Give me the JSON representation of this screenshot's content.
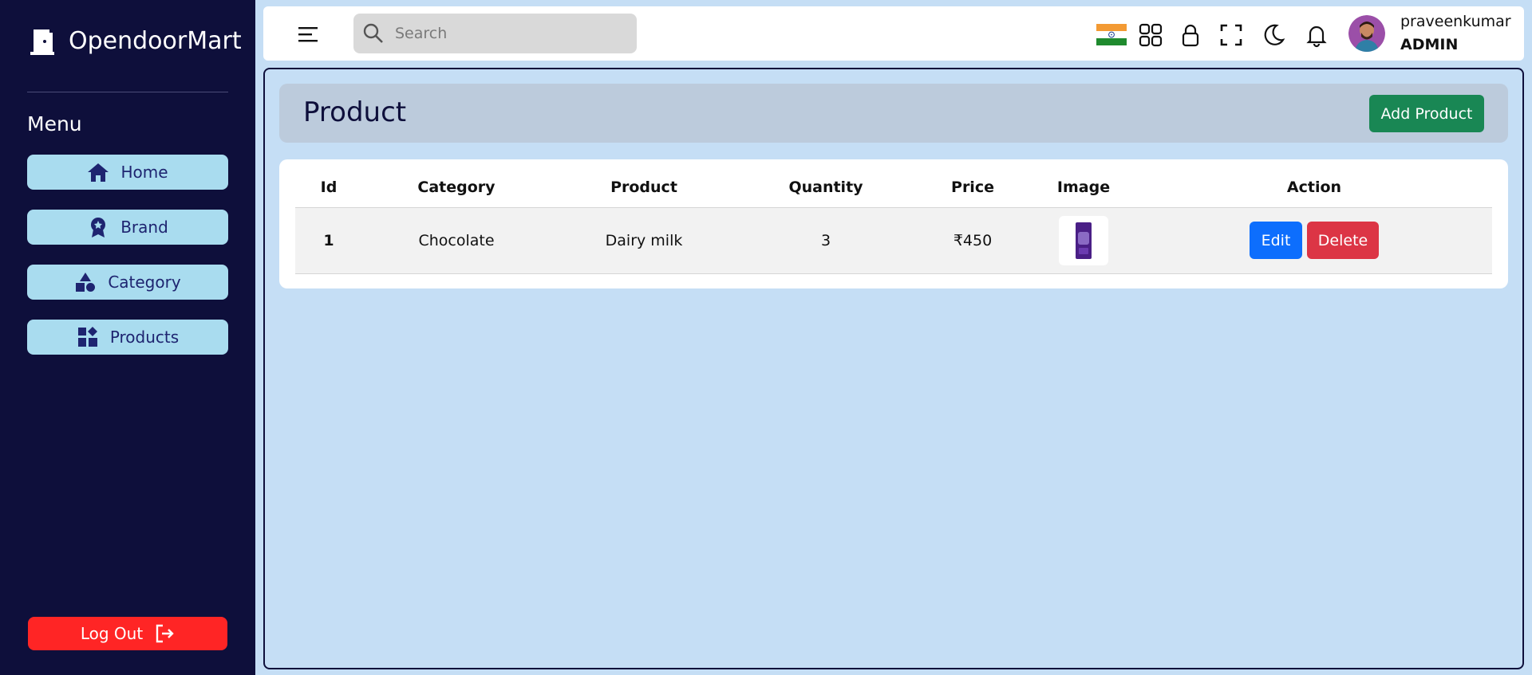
{
  "app": {
    "brand_name": "OpendoorMart",
    "brand_icon": "door-icon"
  },
  "sidebar": {
    "menu_title": "Menu",
    "items": [
      {
        "label": "Home",
        "icon": "home-icon"
      },
      {
        "label": "Brand",
        "icon": "badge-icon"
      },
      {
        "label": "Category",
        "icon": "shapes-icon"
      },
      {
        "label": "Products",
        "icon": "grid-icon"
      }
    ],
    "logout_label": "Log Out"
  },
  "topbar": {
    "search_placeholder": "Search",
    "user": {
      "name": "praveenkumar",
      "role": "ADMIN"
    }
  },
  "page": {
    "title": "Product",
    "add_button_label": "Add Product"
  },
  "table": {
    "columns": [
      "Id",
      "Category",
      "Product",
      "Quantity",
      "Price",
      "Image",
      "Action"
    ],
    "rows": [
      {
        "id": "1",
        "category": "Chocolate",
        "product": "Dairy milk",
        "quantity": "3",
        "price": "₹450",
        "edit_label": "Edit",
        "delete_label": "Delete"
      }
    ]
  },
  "colors": {
    "sidebar_bg": "#0e0f3b",
    "nav_item_bg": "#a9dcef",
    "logout_bg": "#ff2525",
    "main_bg": "#c5def5",
    "add_button": "#198754",
    "edit_button": "#0d6efd",
    "delete_button": "#dc3545"
  }
}
